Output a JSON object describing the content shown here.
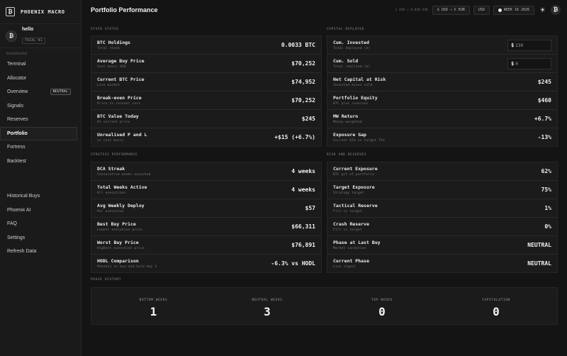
{
  "brand": {
    "icon": "₿",
    "name": "PHOENIX MACRO"
  },
  "user": {
    "avatar": "₿",
    "name": "hello",
    "badge": "TRIAL 91"
  },
  "nav": {
    "section_label": "DASHBOARD",
    "items": [
      {
        "label": "Terminal"
      },
      {
        "label": "Allocator"
      },
      {
        "label": "Overview",
        "badge": "NEUTRAL"
      },
      {
        "label": "Signals"
      },
      {
        "label": "Reserves"
      },
      {
        "label": "Portfolio"
      },
      {
        "label": "Fortress"
      },
      {
        "label": "Backtest"
      }
    ],
    "secondary": [
      {
        "label": "Historical Buys"
      },
      {
        "label": "Phoenix AI"
      },
      {
        "label": "FAQ"
      },
      {
        "label": "Settings"
      },
      {
        "label": "Refresh Data"
      }
    ]
  },
  "header": {
    "title": "Portfolio Performance",
    "rate_text": "1 USD = 0.848 EUR",
    "currency_convert": "$ USD → € EUR",
    "currency": "USD",
    "week": "WEEK 16 2026",
    "theme_icon": "☀",
    "btc_icon": "₿"
  },
  "stack_status": {
    "label": "STACK STATUS",
    "rows": [
      {
        "label": "BTC Holdings",
        "sub": "Total stack",
        "value": "0.0033 BTC"
      },
      {
        "label": "Average Buy Price",
        "sub": "Cost basis USD",
        "value": "$70,252"
      },
      {
        "label": "Current BTC Price",
        "sub": "Live market",
        "value": "$74,952"
      },
      {
        "label": "Break-even Price",
        "sub": "Price to recover cost",
        "value": "$70,252"
      },
      {
        "label": "BTC Value Today",
        "sub": "At current price",
        "value": "$245"
      },
      {
        "label": "Unrealised P and L",
        "sub": "vs cost basis",
        "value": "+$15 (+6.7%)"
      }
    ]
  },
  "capital_deployed": {
    "label": "CAPITAL DEPLOYED",
    "inputs": [
      {
        "label": "Cum. Invested",
        "sub": "Total deployed ($)",
        "currency": "$",
        "value": "230"
      },
      {
        "label": "Cum. Sold",
        "sub": "Total realised ($)",
        "currency": "$",
        "value": "0"
      }
    ],
    "rows": [
      {
        "label": "Net Capital at Risk",
        "sub": "Invested minus sold",
        "value": "$245"
      },
      {
        "label": "Portfolio Equity",
        "sub": "BTC plus reserves",
        "value": "$460"
      },
      {
        "label": "MW Return",
        "sub": "Money-weighted",
        "value": "+6.7%"
      },
      {
        "label": "Exposure Gap",
        "sub": "Current 62% vs target 75%",
        "value": "-13%"
      }
    ]
  },
  "strategy_performance": {
    "label": "STRATEGY PERFORMANCE",
    "rows": [
      {
        "label": "DCA Streak",
        "sub": "Consecutive weeks executed",
        "value": "4 weeks"
      },
      {
        "label": "Total Weeks Active",
        "sub": "All executions",
        "value": "4 weeks"
      },
      {
        "label": "Avg Weekly Deploy",
        "sub": "Per execution",
        "value": "$57"
      },
      {
        "label": "Best Buy Price",
        "sub": "Lowest execution price",
        "value": "$66,311"
      },
      {
        "label": "Worst Buy Price",
        "sub": "Highest execution price",
        "value": "$76,891"
      },
      {
        "label": "HODL Comparison",
        "sub": "Phoenix vs buy-and-hold day 1",
        "value": "-6.3% vs HODL"
      }
    ]
  },
  "risk_reserves": {
    "label": "RISK AND RESERVES",
    "rows": [
      {
        "label": "Current Exposure",
        "sub": "BTC pct of portfolio",
        "value": "62%"
      },
      {
        "label": "Target Exposure",
        "sub": "Strategy target",
        "value": "75%"
      },
      {
        "label": "Tactical Reserve",
        "sub": "Fill vs target",
        "value": "1%"
      },
      {
        "label": "Crash Reserve",
        "sub": "Fill vs target",
        "value": "0%"
      },
      {
        "label": "Phase at Last Buy",
        "sub": "Market condition",
        "value": "NEUTRAL"
      },
      {
        "label": "Current Phase",
        "sub": "Live signal",
        "value": "NEUTRAL"
      }
    ]
  },
  "phase_history": {
    "label": "PHASE HISTORY",
    "cells": [
      {
        "label": "BOTTOM WEEKS",
        "count": "1"
      },
      {
        "label": "NEUTRAL WEEKS",
        "count": "3"
      },
      {
        "label": "TOP WEEKS",
        "count": "0"
      },
      {
        "label": "CAPITULATION",
        "count": "0"
      }
    ]
  }
}
